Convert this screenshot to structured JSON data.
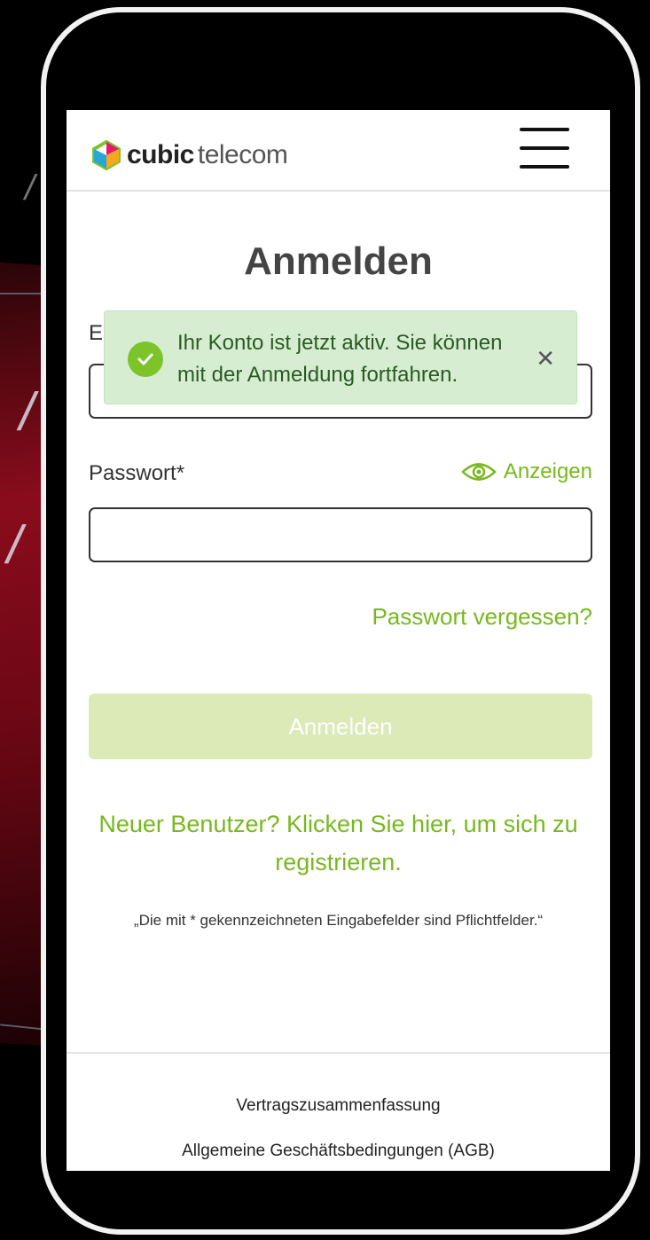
{
  "header": {
    "logo_bold": "cubic",
    "logo_light": "telecom",
    "menu_icon": "hamburger-menu-icon"
  },
  "form": {
    "title": "Anmelden",
    "email_label": "E-Mail*",
    "password_label": "Passwort*",
    "show_password_label": "Anzeigen",
    "show_icon": "eye-icon",
    "forgot_password": "Passwort vergessen?",
    "submit_label": "Anmelden",
    "register_link": "Neuer Benutzer? Klicken Sie hier, um sich zu registrieren.",
    "required_note": "„Die mit * gekennzeichneten Eingabefelder sind Pflichtfelder.“"
  },
  "toast": {
    "message": "Ihr Konto ist jetzt aktiv. Sie können mit der Anmeldung fortfahren.",
    "icon": "check-circle-icon",
    "close_icon": "close-icon",
    "close_symbol": "✕"
  },
  "footer": {
    "links": [
      "Vertragszusammenfassung",
      "Allgemeine Geschäftsbedingungen (AGB)"
    ]
  },
  "colors": {
    "accent": "#78b81e",
    "button_disabled": "#dbeab6",
    "toast_background": "#d6edd2",
    "toast_text": "#2b5a23"
  }
}
